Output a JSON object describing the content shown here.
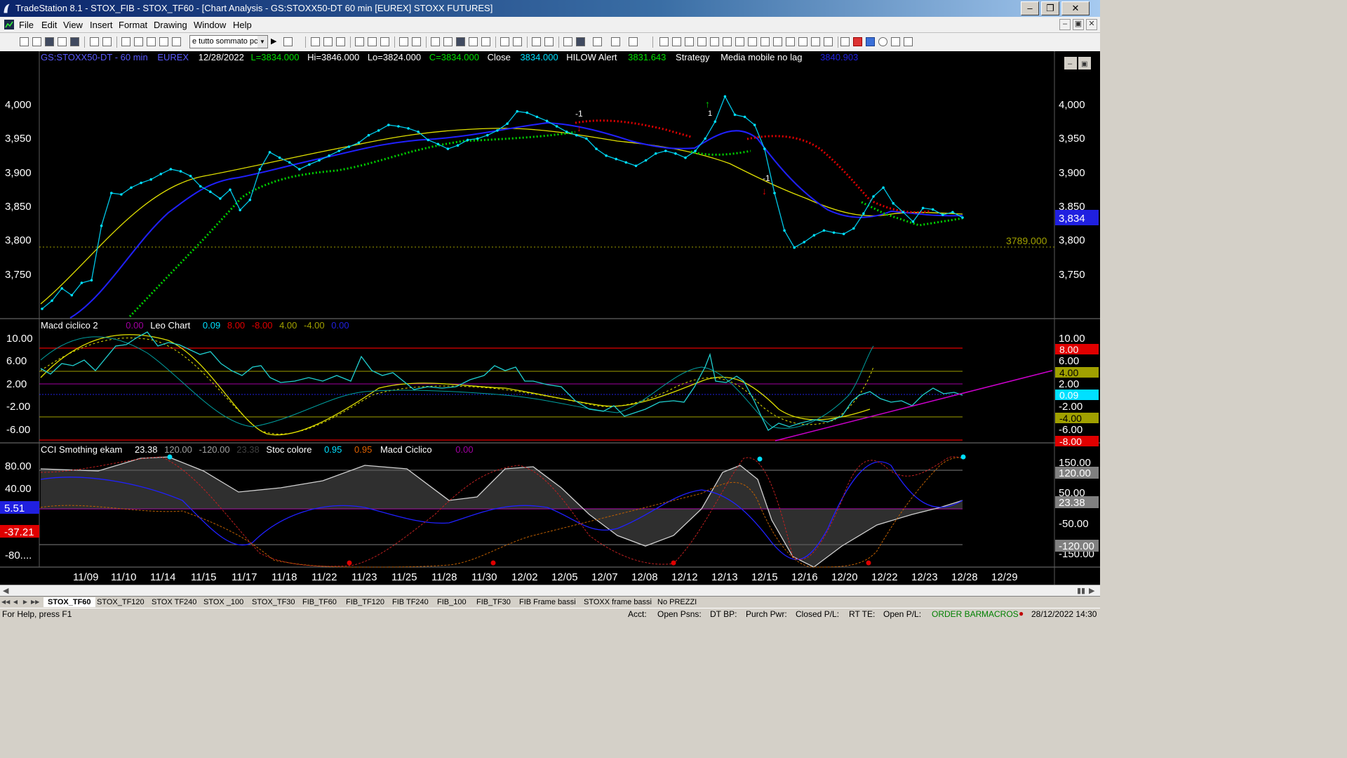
{
  "window": {
    "title": "TradeStation 8.1 - STOX_FIB - STOX_TF60 - [Chart Analysis - GS:STOXX50-DT  60 min  [EUREX] STOXX FUTURES]"
  },
  "menu": [
    "File",
    "Edit",
    "View",
    "Insert",
    "Format",
    "Drawing",
    "Window",
    "Help"
  ],
  "toolbar": {
    "combo_value": "e tutto sommato pc"
  },
  "chart": {
    "header": {
      "symbol": "GS:STOXX50-DT - 60 min",
      "exchange": "EUREX",
      "date": "12/28/2022",
      "last": "L=3834.000",
      "high": "Hi=3846.000",
      "low": "Lo=3824.000",
      "close_c": "C=3834.000",
      "close_label": "Close",
      "close_value": "3834.000",
      "hilow_label": "HILOW Alert",
      "hilow_value": "3831.643",
      "strategy_label": "Strategy",
      "mm_label": "Media mobile no lag",
      "mm_value": "3840.903"
    },
    "price_axis": [
      "4,000",
      "3,950",
      "3,900",
      "3,850",
      "3,800",
      "3,750"
    ],
    "current_price_tag": "3,834",
    "hline_label": "3789.000",
    "markers": {
      "minus1_a": "-1",
      "minus1_b": "-1",
      "one": "1"
    },
    "panel2": {
      "header": {
        "name": "Macd ciclico 2",
        "v0": "0.00",
        "name2": "Leo Chart",
        "v1": "0.09",
        "v2": "8.00",
        "v3": "-8.00",
        "v4": "4.00",
        "v5": "-4.00",
        "v6": "0.00"
      },
      "left_axis": [
        "10.00",
        "6.00",
        "2.00",
        "-2.00",
        "-6.00"
      ],
      "right_axis": [
        "10.00",
        "6.00",
        "2.00",
        "-2.00",
        "-6.00"
      ],
      "tags": {
        "red_top": "8.00",
        "olive_top": "4.00",
        "cyan": "0.09",
        "olive_bot": "-4.00",
        "red_bot": "-8.00"
      }
    },
    "panel3": {
      "header": {
        "name": "CCI Smothing ekam",
        "v1": "23.38",
        "v2": "120.00",
        "v3": "-120.00",
        "v4": "23.38",
        "name2": "Stoc colore",
        "v5": "0.95",
        "v6": "0.95",
        "name3": "Macd Ciclico",
        "v7": "0.00"
      },
      "left_axis": [
        "80.00",
        "40.00",
        "-80...."
      ],
      "left_tag_blue": "5.51",
      "left_tag_red": "-37.21",
      "right_axis": [
        "150.00",
        "50.00",
        "-50.00",
        "-150.00"
      ],
      "right_tags": {
        "t120": "120.00",
        "t2338": "23.38",
        "tm120": "-120.00"
      }
    },
    "dates": [
      "11/09",
      "11/10",
      "11/14",
      "11/15",
      "11/17",
      "11/18",
      "11/22",
      "11/23",
      "11/25",
      "11/28",
      "11/30",
      "12/02",
      "12/05",
      "12/07",
      "12/08",
      "12/12",
      "12/13",
      "12/15",
      "12/16",
      "12/20",
      "12/22",
      "12/23",
      "12/28",
      "12/29"
    ],
    "close_series": [
      3700,
      3712,
      3730,
      3720,
      3738,
      3742,
      3822,
      3870,
      3868,
      3878,
      3885,
      3890,
      3898,
      3905,
      3902,
      3895,
      3880,
      3872,
      3862,
      3875,
      3845,
      3860,
      3905,
      3930,
      3922,
      3915,
      3905,
      3912,
      3918,
      3925,
      3932,
      3938,
      3944,
      3955,
      3962,
      3970,
      3968,
      3965,
      3960,
      3948,
      3942,
      3935,
      3940,
      3948,
      3950,
      3955,
      3962,
      3972,
      3990,
      3988,
      3982,
      3976,
      3968,
      3960,
      3955,
      3950,
      3935,
      3925,
      3920,
      3915,
      3910,
      3918,
      3928,
      3932,
      3928,
      3922,
      3932,
      3950,
      3975,
      4012,
      3985,
      3982,
      3970,
      3935,
      3870,
      3815,
      3790,
      3798,
      3808,
      3815,
      3812,
      3810,
      3818,
      3840,
      3865,
      3878,
      3855,
      3842,
      3828,
      3848,
      3846,
      3838,
      3842,
      3834
    ]
  },
  "tabs": [
    "STOX_TF60",
    "STOX_TF120",
    "STOX TF240",
    "STOX _100",
    "STOX_TF30",
    "FIB_TF60",
    "FIB_TF120",
    "FIB TF240",
    "FIB_100",
    "FIB_TF30",
    "FIB Frame bassi",
    "STOXX frame bassi",
    "No PREZZI"
  ],
  "status": {
    "help": "For Help, press F1",
    "acct": "Acct:",
    "open_psns": "Open Psns:",
    "dt_bp": "DT BP:",
    "purch": "Purch Pwr:",
    "closed_pl": "Closed P/L:",
    "rt_te": "RT TE:",
    "open_pl": "Open P/L:",
    "order_bar": "ORDER BAR",
    "macros": "MACROS",
    "datetime": "28/12/2022 14:30"
  },
  "colors": {
    "price_dots": "#00e0ff",
    "ma_blue": "#2020ff",
    "ma_yellow": "#e0e000",
    "psar_green": "#00d000",
    "psar_red": "#e00000",
    "magenta": "#cc00cc"
  }
}
